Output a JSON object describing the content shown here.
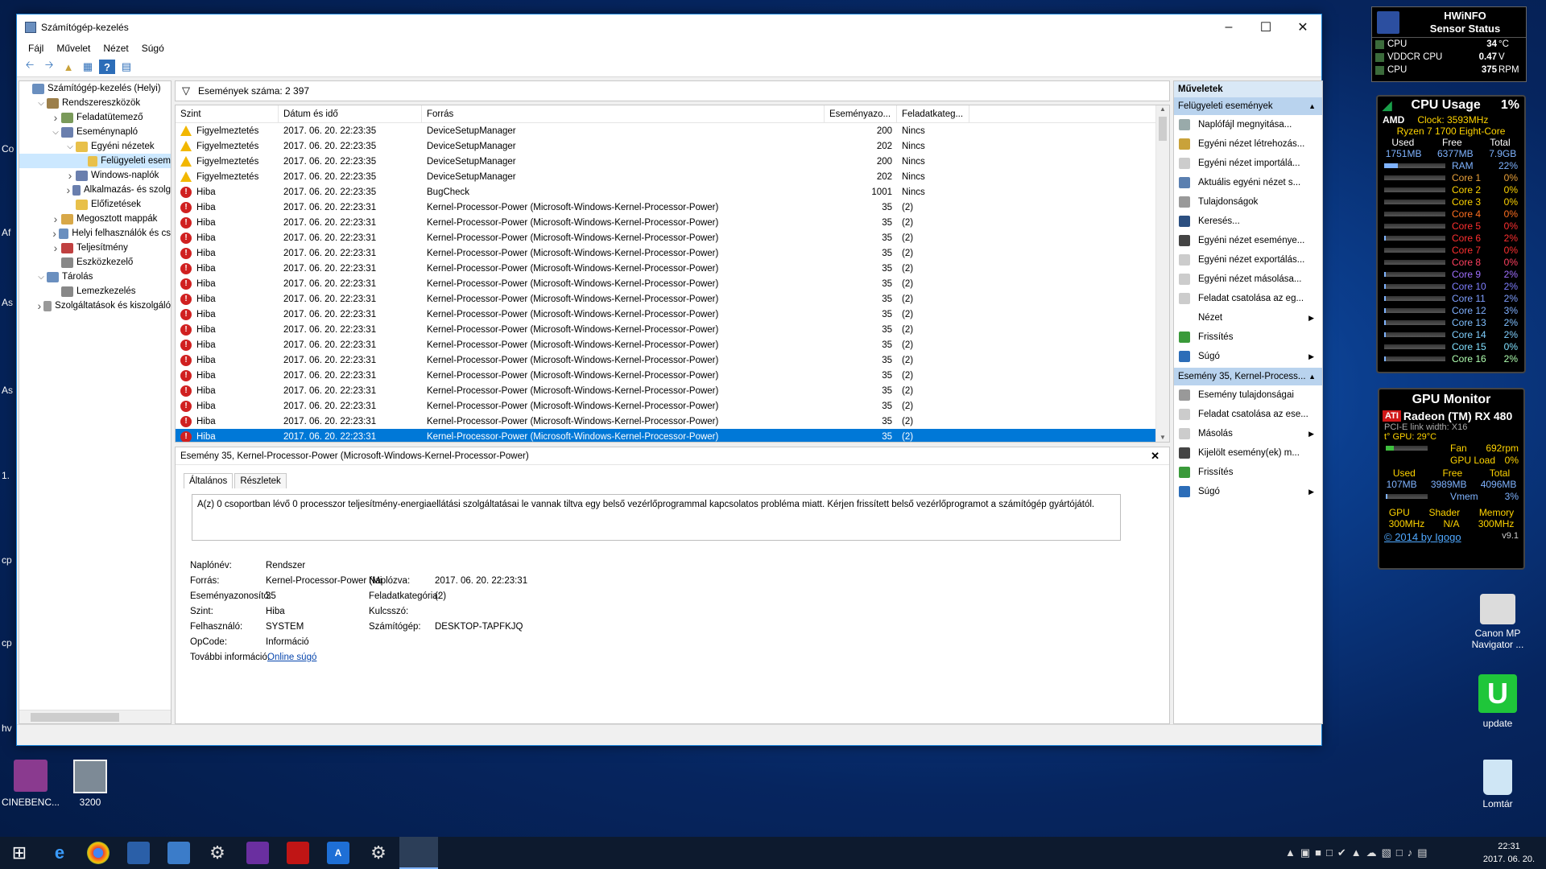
{
  "window": {
    "title": "Számítógép-kezelés",
    "menu": [
      "Fájl",
      "Művelet",
      "Nézet",
      "Súgó"
    ]
  },
  "tree": [
    {
      "label": "Számítógép-kezelés (Helyi)",
      "depth": 0,
      "arrow": ""
    },
    {
      "label": "Rendszereszközök",
      "depth": 1,
      "arrow": "v"
    },
    {
      "label": "Feladatütemező",
      "depth": 2,
      "arrow": ">"
    },
    {
      "label": "Eseménynapló",
      "depth": 2,
      "arrow": "v"
    },
    {
      "label": "Egyéni nézetek",
      "depth": 3,
      "arrow": "v"
    },
    {
      "label": "Felügyeleti esem",
      "depth": 4,
      "arrow": "",
      "selected": true
    },
    {
      "label": "Windows-naplók",
      "depth": 3,
      "arrow": ">"
    },
    {
      "label": "Alkalmazás- és szolg",
      "depth": 3,
      "arrow": ">"
    },
    {
      "label": "Előfizetések",
      "depth": 3,
      "arrow": ""
    },
    {
      "label": "Megosztott mappák",
      "depth": 2,
      "arrow": ">"
    },
    {
      "label": "Helyi felhasználók és cs",
      "depth": 2,
      "arrow": ">"
    },
    {
      "label": "Teljesítmény",
      "depth": 2,
      "arrow": ">"
    },
    {
      "label": "Eszközkezelő",
      "depth": 2,
      "arrow": ""
    },
    {
      "label": "Tárolás",
      "depth": 1,
      "arrow": "v"
    },
    {
      "label": "Lemezkezelés",
      "depth": 2,
      "arrow": ""
    },
    {
      "label": "Szolgáltatások és kiszolgáló",
      "depth": 1,
      "arrow": ">"
    }
  ],
  "events": {
    "count_label": "Események száma: 2 397",
    "columns": [
      "Szint",
      "Dátum és idő",
      "Forrás",
      "Eseményazo...",
      "Feladatkateg..."
    ],
    "rows": [
      [
        "Figyelmeztetés",
        "2017. 06. 20. 22:23:35",
        "DeviceSetupManager",
        "200",
        "Nincs"
      ],
      [
        "Figyelmeztetés",
        "2017. 06. 20. 22:23:35",
        "DeviceSetupManager",
        "202",
        "Nincs"
      ],
      [
        "Figyelmeztetés",
        "2017. 06. 20. 22:23:35",
        "DeviceSetupManager",
        "200",
        "Nincs"
      ],
      [
        "Figyelmeztetés",
        "2017. 06. 20. 22:23:35",
        "DeviceSetupManager",
        "202",
        "Nincs"
      ],
      [
        "Hiba",
        "2017. 06. 20. 22:23:35",
        "BugCheck",
        "1001",
        "Nincs"
      ],
      [
        "Hiba",
        "2017. 06. 20. 22:23:31",
        "Kernel-Processor-Power (Microsoft-Windows-Kernel-Processor-Power)",
        "35",
        "(2)"
      ],
      [
        "Hiba",
        "2017. 06. 20. 22:23:31",
        "Kernel-Processor-Power (Microsoft-Windows-Kernel-Processor-Power)",
        "35",
        "(2)"
      ],
      [
        "Hiba",
        "2017. 06. 20. 22:23:31",
        "Kernel-Processor-Power (Microsoft-Windows-Kernel-Processor-Power)",
        "35",
        "(2)"
      ],
      [
        "Hiba",
        "2017. 06. 20. 22:23:31",
        "Kernel-Processor-Power (Microsoft-Windows-Kernel-Processor-Power)",
        "35",
        "(2)"
      ],
      [
        "Hiba",
        "2017. 06. 20. 22:23:31",
        "Kernel-Processor-Power (Microsoft-Windows-Kernel-Processor-Power)",
        "35",
        "(2)"
      ],
      [
        "Hiba",
        "2017. 06. 20. 22:23:31",
        "Kernel-Processor-Power (Microsoft-Windows-Kernel-Processor-Power)",
        "35",
        "(2)"
      ],
      [
        "Hiba",
        "2017. 06. 20. 22:23:31",
        "Kernel-Processor-Power (Microsoft-Windows-Kernel-Processor-Power)",
        "35",
        "(2)"
      ],
      [
        "Hiba",
        "2017. 06. 20. 22:23:31",
        "Kernel-Processor-Power (Microsoft-Windows-Kernel-Processor-Power)",
        "35",
        "(2)"
      ],
      [
        "Hiba",
        "2017. 06. 20. 22:23:31",
        "Kernel-Processor-Power (Microsoft-Windows-Kernel-Processor-Power)",
        "35",
        "(2)"
      ],
      [
        "Hiba",
        "2017. 06. 20. 22:23:31",
        "Kernel-Processor-Power (Microsoft-Windows-Kernel-Processor-Power)",
        "35",
        "(2)"
      ],
      [
        "Hiba",
        "2017. 06. 20. 22:23:31",
        "Kernel-Processor-Power (Microsoft-Windows-Kernel-Processor-Power)",
        "35",
        "(2)"
      ],
      [
        "Hiba",
        "2017. 06. 20. 22:23:31",
        "Kernel-Processor-Power (Microsoft-Windows-Kernel-Processor-Power)",
        "35",
        "(2)"
      ],
      [
        "Hiba",
        "2017. 06. 20. 22:23:31",
        "Kernel-Processor-Power (Microsoft-Windows-Kernel-Processor-Power)",
        "35",
        "(2)"
      ],
      [
        "Hiba",
        "2017. 06. 20. 22:23:31",
        "Kernel-Processor-Power (Microsoft-Windows-Kernel-Processor-Power)",
        "35",
        "(2)"
      ],
      [
        "Hiba",
        "2017. 06. 20. 22:23:31",
        "Kernel-Processor-Power (Microsoft-Windows-Kernel-Processor-Power)",
        "35",
        "(2)"
      ],
      [
        "Hiba",
        "2017. 06. 20. 22:23:31",
        "Kernel-Processor-Power (Microsoft-Windows-Kernel-Processor-Power)",
        "35",
        "(2)"
      ]
    ],
    "selected_row": 20
  },
  "detail": {
    "title": "Esemény 35, Kernel-Processor-Power (Microsoft-Windows-Kernel-Processor-Power)",
    "tabs": [
      "Általános",
      "Részletek"
    ],
    "description": "A(z) 0 csoportban lévő 0 processzor teljesítmény-energiaellátási szolgáltatásai le vannak tiltva egy belső vezérlőprogrammal kapcsolatos probléma miatt. Kérjen frissített belső vezérlőprogramot a számítógép gyártójától.",
    "log_label": "Naplónév:",
    "log": "Rendszer",
    "source_label": "Forrás:",
    "source": "Kernel-Processor-Power (Mi",
    "logged_label": "Naplózva:",
    "logged": "2017. 06. 20. 22:23:31",
    "id_label": "Eseményazonosító:",
    "id": "35",
    "task_label": "Feladatkategória:",
    "task": "(2)",
    "level_label": "Szint:",
    "level": "Hiba",
    "kw_label": "Kulcsszó:",
    "user_label": "Felhasználó:",
    "user": "SYSTEM",
    "comp_label": "Számítógép:",
    "comp": "DESKTOP-TAPFKJQ",
    "opcode_label": "OpCode:",
    "opcode": "Információ",
    "more_label": "További információ:",
    "more_link": "Online súgó"
  },
  "actions": {
    "header": "Műveletek",
    "group1": "Felügyeleti események",
    "items1": [
      "Naplófájl megnyitása...",
      "Egyéni nézet létrehozás...",
      "Egyéni nézet importálá...",
      "Aktuális egyéni nézet s...",
      "Tulajdonságok",
      "Keresés...",
      "Egyéni nézet eseménye...",
      "Egyéni nézet exportálás...",
      "Egyéni nézet másolása...",
      "Feladat csatolása az eg...",
      "Nézet",
      "Frissítés",
      "Súgó"
    ],
    "group2": "Esemény 35, Kernel-Process...",
    "items2": [
      "Esemény tulajdonságai",
      "Feladat csatolása az ese...",
      "Másolás",
      "Kijelölt esemény(ek) m...",
      "Frissítés",
      "Súgó"
    ]
  },
  "hwinfo": {
    "title1": "HWiNFO",
    "title2": "Sensor Status",
    "rows": [
      [
        "CPU",
        "34",
        "°C"
      ],
      [
        "VDDCR CPU",
        "0.47",
        "V"
      ],
      [
        "CPU",
        "375",
        "RPM"
      ]
    ]
  },
  "cpu": {
    "title": "CPU Usage",
    "pct": "1%",
    "brand": "AMD",
    "clock": "Clock: 3593MHz",
    "model": "Ryzen 7 1700 Eight-Core",
    "mem_hdr": [
      "Used",
      "Free",
      "Total"
    ],
    "mem_vals": [
      "1751MB",
      "6377MB",
      "7.9GB"
    ],
    "ram_label": "RAM",
    "ram_pct": "22%",
    "ram_frac": 0.22,
    "cores": [
      [
        "Core 1",
        "0%"
      ],
      [
        "Core 2",
        "0%"
      ],
      [
        "Core 3",
        "0%"
      ],
      [
        "Core 4",
        "0%"
      ],
      [
        "Core 5",
        "0%"
      ],
      [
        "Core 6",
        "2%"
      ],
      [
        "Core 7",
        "0%"
      ],
      [
        "Core 8",
        "0%"
      ],
      [
        "Core 9",
        "2%"
      ],
      [
        "Core 10",
        "2%"
      ],
      [
        "Core 11",
        "2%"
      ],
      [
        "Core 12",
        "3%"
      ],
      [
        "Core 13",
        "2%"
      ],
      [
        "Core 14",
        "2%"
      ],
      [
        "Core 15",
        "0%"
      ],
      [
        "Core 16",
        "2%"
      ]
    ],
    "core_colors": [
      "#e9a13b",
      "#ffd400",
      "#ffd400",
      "#ff7020",
      "#ff3030",
      "#ff3030",
      "#ff3030",
      "#ff4060",
      "#a070ff",
      "#7f7fff",
      "#7f9fff",
      "#7fb0ff",
      "#7fc0ff",
      "#80d0ff",
      "#80e0ff",
      "#b0ffb0"
    ]
  },
  "gpu": {
    "title": "GPU Monitor",
    "brand": "ATI",
    "name": "Radeon (TM) RX 480",
    "pcie": "PCI-E link width: X16",
    "temp": "t° GPU: 29°C",
    "fan_label": "Fan",
    "fan": "692rpm",
    "load_label": "GPU Load",
    "load": "0%",
    "mem_hdr": [
      "Used",
      "Free",
      "Total"
    ],
    "mem_vals": [
      "107MB",
      "3989MB",
      "4096MB"
    ],
    "vmem_label": "Vmem",
    "vmem": "3%",
    "clk_hdr": [
      "GPU",
      "Shader",
      "Memory"
    ],
    "clk_vals": [
      "300MHz",
      "N/A",
      "300MHz"
    ],
    "credit": "© 2014 by Igogo",
    "ver": "v9.1"
  },
  "desktop": {
    "left_labels": [
      "Co",
      "Af",
      "As",
      "As",
      "1.",
      "cp",
      "cp",
      "hv"
    ],
    "icons": [
      "Canon MP Navigator ...",
      "update",
      "Lomtár",
      "CINEBENC...",
      "3200"
    ]
  },
  "clock": {
    "time": "22:31",
    "date": "2017. 06. 20."
  }
}
